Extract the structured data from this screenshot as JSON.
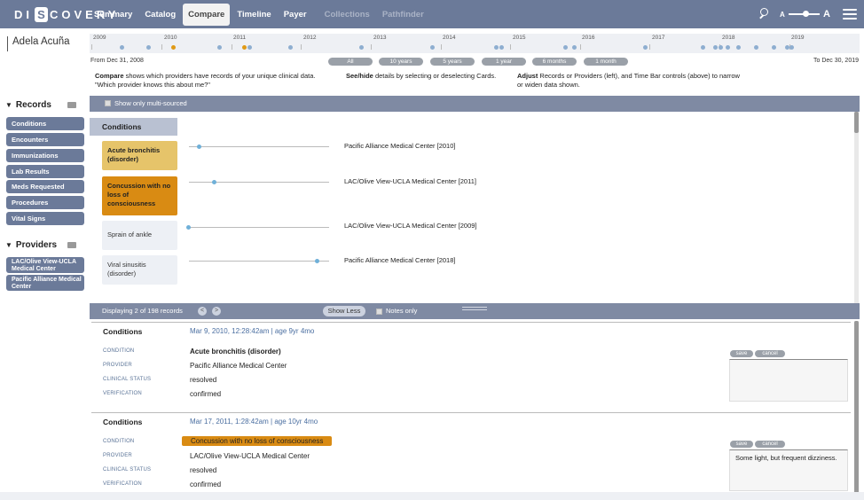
{
  "app": {
    "logo_left": "DI",
    "logo_mark": "S",
    "logo_right": "COVERY"
  },
  "nav": {
    "tabs": [
      {
        "label": "Summary"
      },
      {
        "label": "Catalog"
      },
      {
        "label": "Compare"
      },
      {
        "label": "Timeline"
      },
      {
        "label": "Payer"
      },
      {
        "label": "Collections"
      },
      {
        "label": "Pathfinder"
      }
    ],
    "text_size_small": "A",
    "text_size_large": "A"
  },
  "patient": {
    "name": "Adela Acuña"
  },
  "sidebar": {
    "records_title": "Records",
    "records": [
      {
        "label": "Conditions"
      },
      {
        "label": "Encounters"
      },
      {
        "label": "Immunizations"
      },
      {
        "label": "Lab Results"
      },
      {
        "label": "Meds Requested"
      },
      {
        "label": "Procedures"
      },
      {
        "label": "Vital Signs"
      }
    ],
    "providers_title": "Providers",
    "providers": [
      {
        "label": "LAC/Olive View-UCLA Medical Center"
      },
      {
        "label": "Pacific Alliance Medical Center"
      }
    ]
  },
  "timeline": {
    "years": [
      "2009",
      "2010",
      "2011",
      "2012",
      "2013",
      "2014",
      "2015",
      "2016",
      "2017",
      "2018",
      "2019"
    ],
    "from_label": "From Dec 31, 2008",
    "to_label": "To Dec 30, 2019",
    "ranges": [
      {
        "label": "All"
      },
      {
        "label": "10 years"
      },
      {
        "label": "5 years"
      },
      {
        "label": "1 year"
      },
      {
        "label": "6 months"
      },
      {
        "label": "1 month"
      }
    ]
  },
  "help": {
    "compare_bold": "Compare",
    "compare_text": " shows which providers have records of your unique clinical data.",
    "compare_text2": "\"Which provider knows this about me?\"",
    "seehide_bold": "See/hide",
    "seehide_text": " details by selecting or deselecting Cards.",
    "adjust_bold": "Adjust",
    "adjust_text": " Records or Providers (left), and Time Bar controls (above) to narrow",
    "adjust_text2": "or widen data shown."
  },
  "compare": {
    "multi_sourced_label": "Show only multi-sourced",
    "category_title": "Conditions",
    "cards": [
      {
        "label": "Acute bronchitis (disorder)",
        "provider": "Pacific Alliance Medical Center [2010]"
      },
      {
        "label": "Concussion with no loss of consciousness",
        "provider": "LAC/Olive View-UCLA Medical Center [2011]"
      },
      {
        "label": "Sprain of ankle",
        "provider": "LAC/Olive View-UCLA Medical Center [2009]"
      },
      {
        "label": "Viral sinusitis (disorder)",
        "provider": "Pacific Alliance Medical Center [2018]"
      }
    ]
  },
  "status": {
    "count_text": "Displaying 2 of 198 records",
    "prev": "<",
    "next": ">",
    "show_less": "Show Less",
    "notes_only": "Notes only"
  },
  "records": [
    {
      "title": "Conditions",
      "date": "Mar 9, 2010, 12:28:42am   |  age 9yr 4mo",
      "labels": [
        "CONDITION",
        "PROVIDER",
        "CLINICAL STATUS",
        "VERIFICATION"
      ],
      "condition": "Acute bronchitis (disorder)",
      "provider": "Pacific Alliance Medical Center",
      "clinical_status": "resolved",
      "verification": "confirmed",
      "save": "save",
      "cancel": "cancel",
      "note": ""
    },
    {
      "title": "Conditions",
      "date": "Mar 17, 2011, 1:28:42am   |  age 10yr 4mo",
      "labels": [
        "CONDITION",
        "PROVIDER",
        "CLINICAL STATUS",
        "VERIFICATION"
      ],
      "condition": "Concussion with no loss of consciousness",
      "provider": "LAC/Olive View-UCLA Medical Center",
      "clinical_status": "resolved",
      "verification": "confirmed",
      "save": "save",
      "cancel": "cancel",
      "note": "Some light, but frequent dizziness."
    }
  ],
  "colors": {
    "nav": "#6b7a99",
    "accent_orange": "#d98b13",
    "accent_gold": "#e6c46a",
    "dot_blue": "#6fb0d8"
  }
}
